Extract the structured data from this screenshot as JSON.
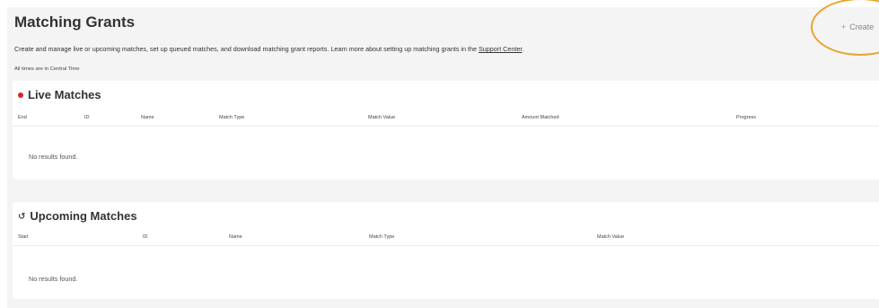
{
  "header": {
    "title": "Matching Grants",
    "create_label": "Create",
    "create_icon": "plus-icon",
    "description_prefix": "Create and manage live or upcoming matches, set up queued matches, and download matching grant reports. Learn more about setting up matching grants in the ",
    "support_link": "Support Center",
    "description_suffix": ".",
    "timezone_note": "All times are in Central Time",
    "highlight_color": "#e8a52a"
  },
  "live": {
    "title": "Live Matches",
    "status_color": "#e02020",
    "columns": [
      "End",
      "ID",
      "Name",
      "Match Type",
      "Match Value",
      "Amount Matched",
      "Progress"
    ],
    "empty_text": "No results found."
  },
  "upcoming": {
    "title": "Upcoming Matches",
    "icon": "history-icon",
    "columns": [
      "Start",
      "ID",
      "Name",
      "Match Type",
      "Match Value"
    ],
    "empty_text": "No results found."
  }
}
